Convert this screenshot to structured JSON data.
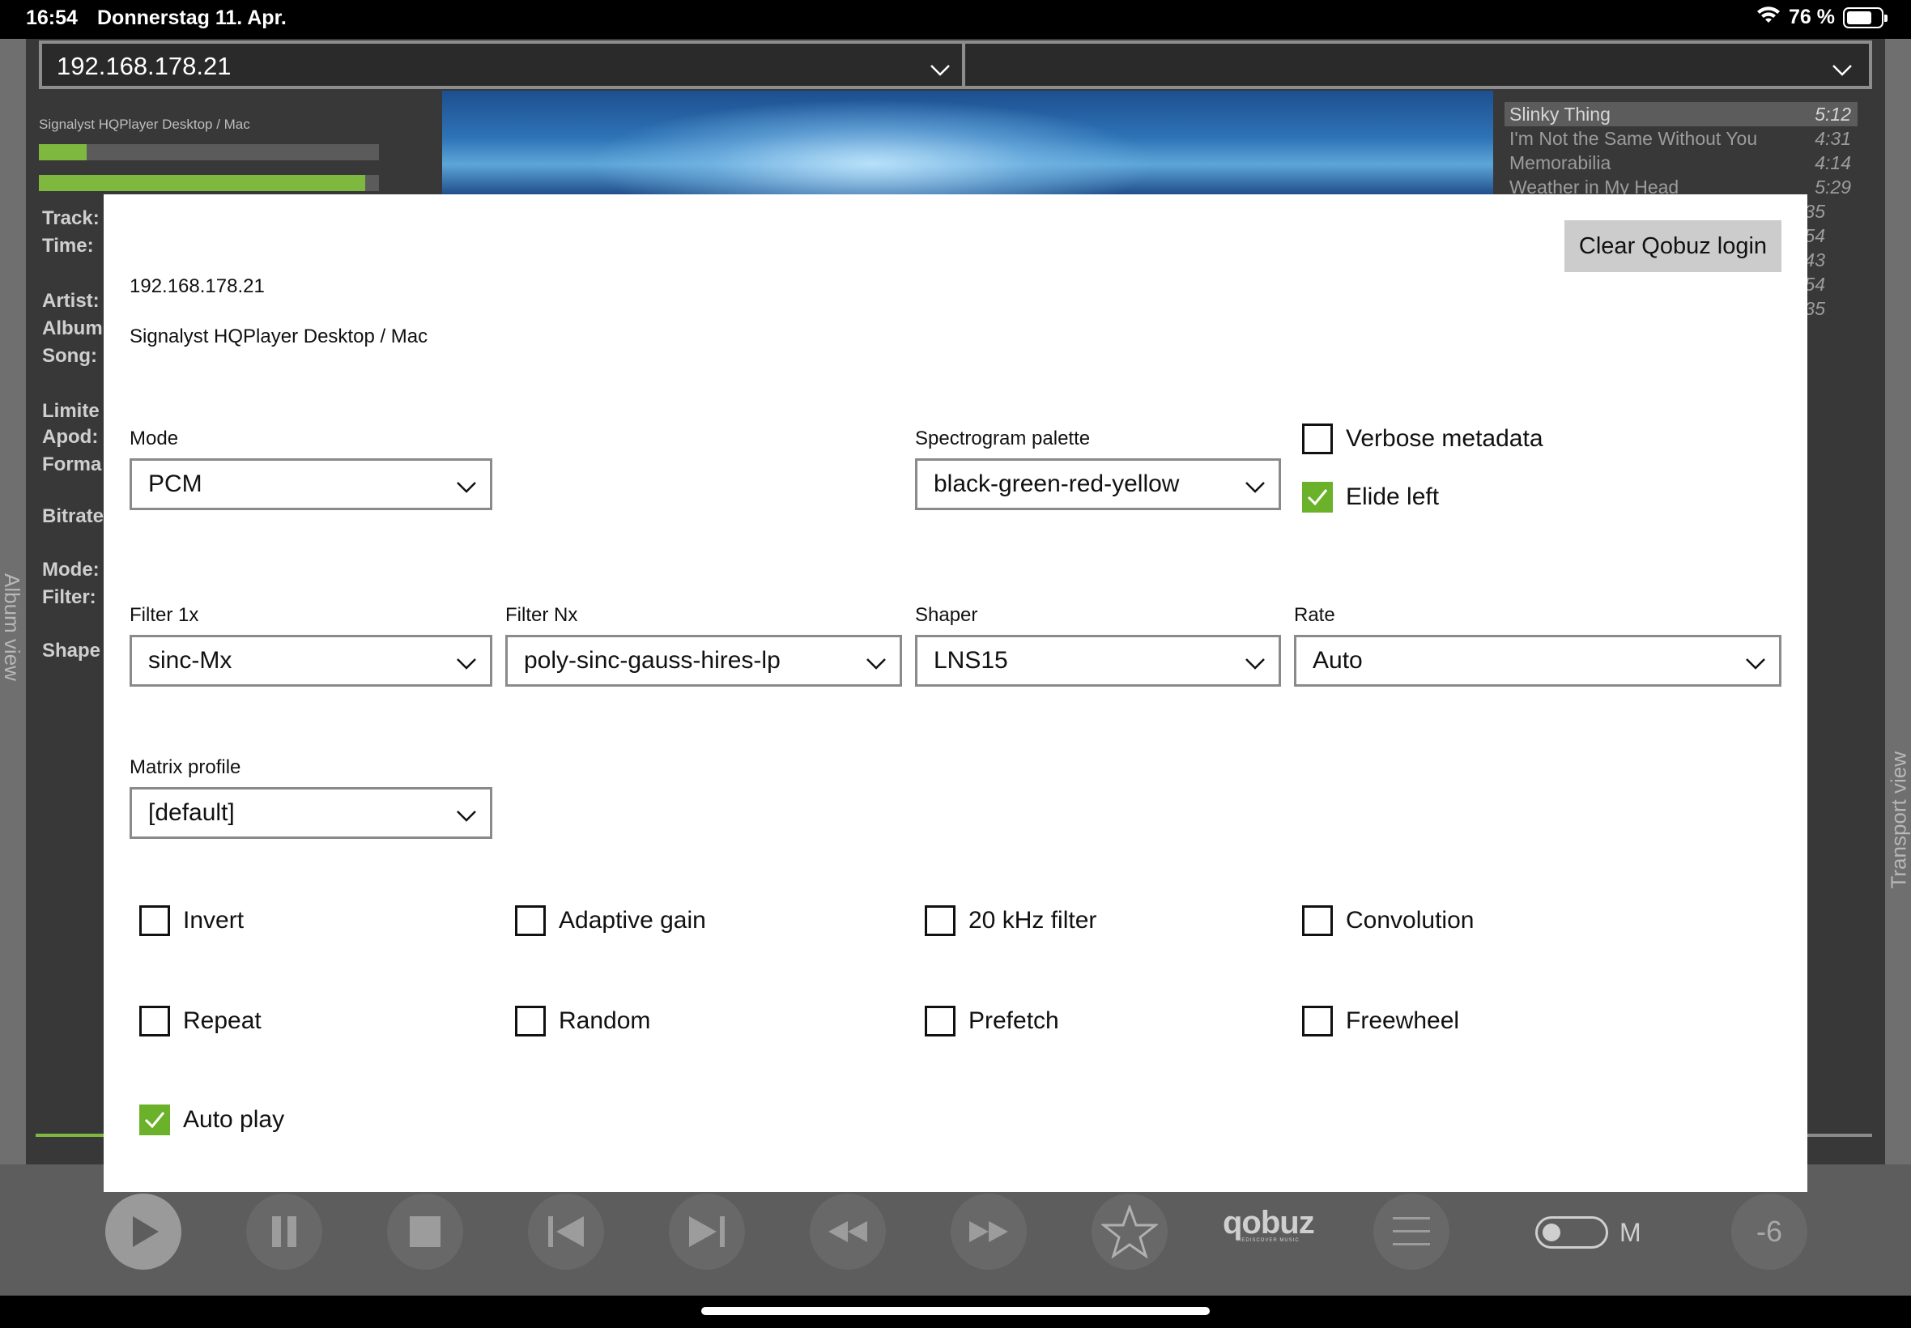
{
  "status_bar": {
    "time": "16:54",
    "date": "Donnerstag 11. Apr.",
    "battery": "76 %",
    "battery_level": 0.76
  },
  "top": {
    "host_combo": "192.168.178.21",
    "second_combo": ""
  },
  "left_panel": {
    "device": "Signalyst HQPlayer Desktop / Mac",
    "meter1_level": 0.14,
    "meter2_level": 0.96,
    "labels": [
      "Track:",
      "Time:",
      "Artist:",
      "Album",
      "Song:",
      "Limite",
      "Apod:",
      "Forma",
      "Bitrate",
      "Mode:",
      "Filter:",
      "Shape"
    ]
  },
  "side_labels": {
    "left": "Album view",
    "right": "Transport view"
  },
  "playlist": [
    {
      "title": "Slinky Thing",
      "duration": "5:12",
      "selected": true
    },
    {
      "title": "I'm Not the Same Without You",
      "duration": "4:31"
    },
    {
      "title": "Memorabilia",
      "duration": "4:14"
    },
    {
      "title": "Weather in My Head",
      "duration": "5:29"
    }
  ],
  "playlist_extra_durations": [
    "35",
    "54",
    "43",
    "54",
    "35"
  ],
  "dialog": {
    "host": "192.168.178.21",
    "device": "Signalyst HQPlayer Desktop / Mac",
    "clear_button": "Clear Qobuz login",
    "mode": {
      "label": "Mode",
      "value": "PCM"
    },
    "palette": {
      "label": "Spectrogram palette",
      "value": "black-green-red-yellow"
    },
    "filter1x": {
      "label": "Filter 1x",
      "value": "sinc-Mx"
    },
    "filternx": {
      "label": "Filter Nx",
      "value": "poly-sinc-gauss-hires-lp"
    },
    "shaper": {
      "label": "Shaper",
      "value": "LNS15"
    },
    "rate": {
      "label": "Rate",
      "value": "Auto"
    },
    "matrix": {
      "label": "Matrix profile",
      "value": "[default]"
    },
    "checkboxes": {
      "verbose": {
        "label": "Verbose metadata",
        "checked": false
      },
      "elide": {
        "label": "Elide left",
        "checked": true
      },
      "invert": {
        "label": "Invert",
        "checked": false
      },
      "adaptive": {
        "label": "Adaptive gain",
        "checked": false
      },
      "khz20": {
        "label": "20 kHz filter",
        "checked": false
      },
      "convolution": {
        "label": "Convolution",
        "checked": false
      },
      "repeat": {
        "label": "Repeat",
        "checked": false
      },
      "random": {
        "label": "Random",
        "checked": false
      },
      "prefetch": {
        "label": "Prefetch",
        "checked": false
      },
      "freewheel": {
        "label": "Freewheel",
        "checked": false
      },
      "autoplay": {
        "label": "Auto play",
        "checked": true
      }
    }
  },
  "transport": {
    "qobuz": "qobuz",
    "qobuz_tagline": "REDISCOVER MUSIC",
    "toggle_label": "M",
    "volume": "-6"
  },
  "colors": {
    "accent_green": "#6bb22a",
    "meter_green": "#7fb83f",
    "dialog_bg": "#ffffff",
    "app_bg": "#383838"
  }
}
